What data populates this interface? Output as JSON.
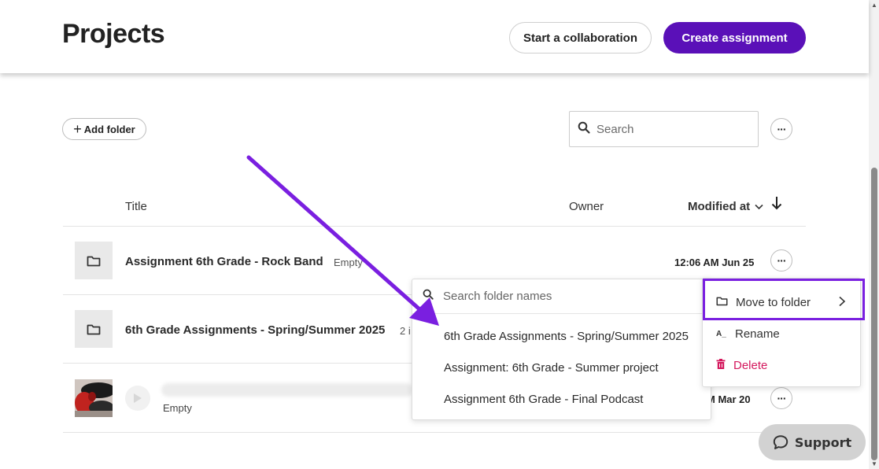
{
  "header": {
    "title": "Projects",
    "collab_label": "Start a collaboration",
    "create_label": "Create assignment"
  },
  "toolbar": {
    "add_folder_label": "Add folder",
    "search_placeholder": "Search"
  },
  "table": {
    "columns": {
      "title": "Title",
      "owner": "Owner",
      "modified": "Modified at"
    },
    "rows": [
      {
        "name": "Assignment 6th Grade - Rock Band",
        "badge": "Empty",
        "date": "12:06 AM Jun 25"
      },
      {
        "name": "6th Grade Assignments - Spring/Summer 2025",
        "badge": "2 i",
        "date": ""
      },
      {
        "name": "",
        "badge": "Empty",
        "date": "M Mar 20"
      }
    ]
  },
  "folder_dropdown": {
    "placeholder": "Search folder names",
    "items": [
      "6th Grade Assignments - Spring/Summer 2025",
      "Assignment: 6th Grade - Summer project",
      "Assignment 6th Grade - Final Podcast"
    ]
  },
  "context_menu": {
    "move": "Move to folder",
    "rename_icon": "A_",
    "rename": "Rename",
    "delete": "Delete"
  },
  "support": {
    "label": "Support"
  },
  "colors": {
    "brand": "#5a10b8",
    "highlight": "#7a1fe0",
    "danger": "#d4185d"
  },
  "icons": [
    "search-icon",
    "plus-icon",
    "folder-icon",
    "sort-arrow-icon",
    "chevron-down-icon",
    "chevron-right-icon",
    "trash-icon",
    "rename-icon",
    "play-icon",
    "chat-bubble-icon"
  ]
}
